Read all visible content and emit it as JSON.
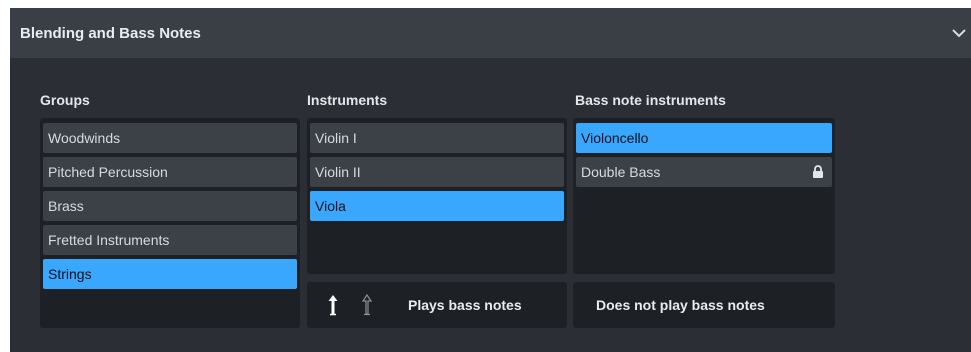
{
  "header": {
    "title": "Blending and Bass Notes"
  },
  "groups": {
    "title": "Groups",
    "items": [
      "Woodwinds",
      "Pitched Percussion",
      "Brass",
      "Fretted Instruments",
      "Strings"
    ],
    "selected": "Strings"
  },
  "instruments": {
    "title": "Instruments",
    "items": [
      "Violin I",
      "Violin II",
      "Viola"
    ],
    "selected": "Viola"
  },
  "bass": {
    "title": "Bass note instruments",
    "items": [
      "Violoncello",
      "Double Bass"
    ],
    "selected": "Violoncello",
    "locked": "Double Bass"
  },
  "legend": {
    "plays": "Plays bass notes",
    "not_plays": "Does not play bass notes"
  },
  "icons": {
    "collapse": "chevron-down-icon",
    "lock": "lock-icon",
    "plays": "plays-bass-arrow-icon",
    "not_plays": "not-plays-bass-arrow-icon"
  },
  "colors": {
    "accent": "#3aa7ff",
    "panel": "#2b2f35",
    "header": "#3a3f46",
    "list_bg": "#1d2024",
    "item_bg": "#3c4148"
  }
}
